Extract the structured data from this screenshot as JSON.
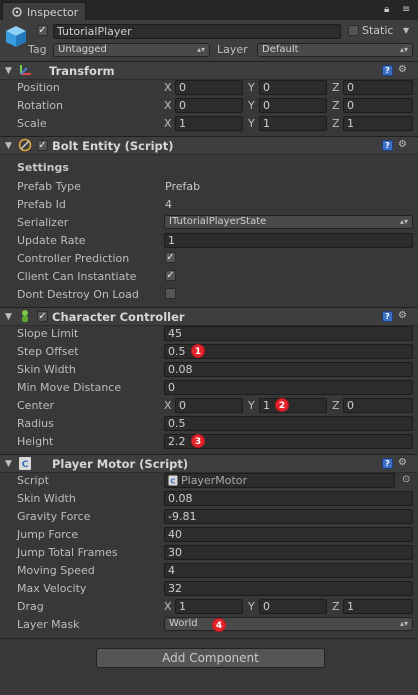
{
  "tab": {
    "title": "Inspector"
  },
  "object": {
    "active": true,
    "name": "TutorialPlayer",
    "static_label": "Static",
    "tag_label": "Tag",
    "tag_value": "Untagged",
    "layer_label": "Layer",
    "layer_value": "Default"
  },
  "transform": {
    "title": "Transform",
    "rows": [
      {
        "label": "Position",
        "x": "0",
        "y": "0",
        "z": "0"
      },
      {
        "label": "Rotation",
        "x": "0",
        "y": "0",
        "z": "0"
      },
      {
        "label": "Scale",
        "x": "1",
        "y": "1",
        "z": "1"
      }
    ]
  },
  "axis": {
    "x": "X",
    "y": "Y",
    "z": "Z"
  },
  "bolt": {
    "title": "Bolt Entity (Script)",
    "enabled": true,
    "settings_label": "Settings",
    "prefab_type_label": "Prefab Type",
    "prefab_type_value": "Prefab",
    "prefab_id_label": "Prefab Id",
    "prefab_id_value": "4",
    "serializer_label": "Serializer",
    "serializer_value": "ITutorialPlayerState",
    "update_rate_label": "Update Rate",
    "update_rate_value": "1",
    "controller_prediction_label": "Controller Prediction",
    "controller_prediction": true,
    "client_can_instantiate_label": "Client Can Instantiate",
    "client_can_instantiate": true,
    "dont_destroy_label": "Dont Destroy On Load",
    "dont_destroy": false
  },
  "character_controller": {
    "title": "Character Controller",
    "enabled": true,
    "slope_limit_label": "Slope Limit",
    "slope_limit": "45",
    "step_offset_label": "Step Offset",
    "step_offset": "0.5",
    "skin_width_label": "Skin Width",
    "skin_width": "0.08",
    "min_move_label": "Min Move Distance",
    "min_move": "0",
    "center_label": "Center",
    "center_x": "0",
    "center_y": "1",
    "center_z": "0",
    "radius_label": "Radius",
    "radius": "0.5",
    "height_label": "Height",
    "height": "2.2"
  },
  "player_motor": {
    "title": "Player Motor (Script)",
    "script_label": "Script",
    "script_value": "PlayerMotor",
    "skin_width_label": "Skin Width",
    "skin_width": "0.08",
    "gravity_label": "Gravity Force",
    "gravity": "-9.81",
    "jump_force_label": "Jump Force",
    "jump_force": "40",
    "jump_frames_label": "Jump Total Frames",
    "jump_frames": "30",
    "moving_speed_label": "Moving Speed",
    "moving_speed": "4",
    "max_velocity_label": "Max Velocity",
    "max_velocity": "32",
    "drag_label": "Drag",
    "drag_x": "1",
    "drag_y": "0",
    "drag_z": "1",
    "layer_mask_label": "Layer Mask",
    "layer_mask": "World"
  },
  "badges": [
    "1",
    "2",
    "3",
    "4"
  ],
  "add_component_label": "Add Component",
  "colors": {
    "badge": "#e3242b",
    "help": "#3d6fc4",
    "background": "#383838"
  }
}
